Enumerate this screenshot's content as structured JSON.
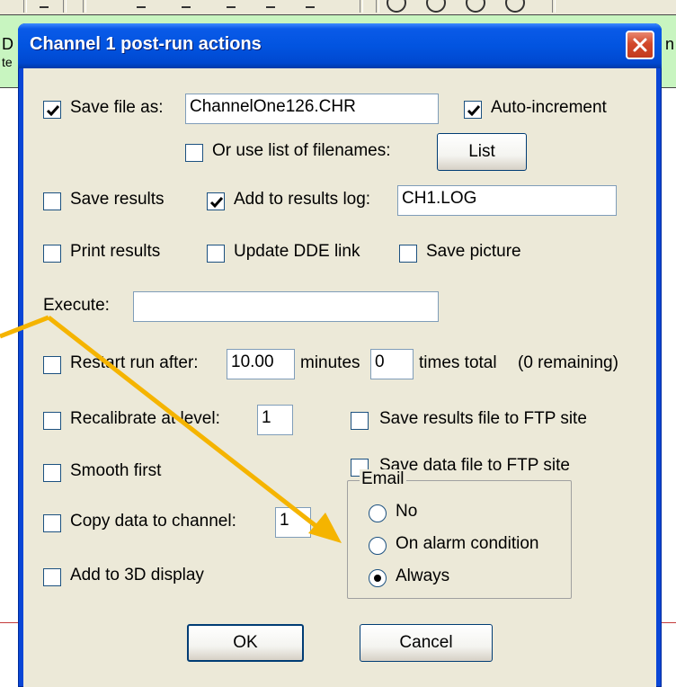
{
  "dialog": {
    "title": "Channel 1 post-run actions",
    "save_file": {
      "label": "Save file as:",
      "checked": true,
      "value": "ChannelOne126.CHR"
    },
    "auto_increment": {
      "label": "Auto-increment",
      "checked": true
    },
    "use_list": {
      "label": "Or use list of filenames:",
      "checked": false
    },
    "list_button": "List",
    "save_results": {
      "label": "Save results",
      "checked": false
    },
    "add_to_log": {
      "label": "Add to results log:",
      "checked": true,
      "value": "CH1.LOG"
    },
    "print_results": {
      "label": "Print results",
      "checked": false
    },
    "update_dde": {
      "label": "Update DDE link",
      "checked": false
    },
    "save_picture": {
      "label": "Save picture",
      "checked": false
    },
    "execute": {
      "label": "Execute:",
      "value": ""
    },
    "restart": {
      "label": "Restart run after:",
      "checked": false,
      "minutes_value": "10.00",
      "minutes_label": "minutes",
      "times_value": "0",
      "times_label": "times total",
      "remaining": "(0 remaining)"
    },
    "recalibrate": {
      "label": "Recalibrate at level:",
      "checked": false,
      "value": "1"
    },
    "save_results_ftp": {
      "label": "Save results file to FTP site",
      "checked": false
    },
    "smooth_first": {
      "label": "Smooth first",
      "checked": false
    },
    "save_data_ftp": {
      "label": "Save data file to FTP site",
      "checked": false
    },
    "copy_data": {
      "label": "Copy data to channel:",
      "checked": false,
      "value": "1"
    },
    "add_3d": {
      "label": "Add to 3D display",
      "checked": false
    },
    "email": {
      "legend": "Email",
      "options": [
        {
          "label": "No",
          "selected": false
        },
        {
          "label": "On alarm condition",
          "selected": false
        },
        {
          "label": "Always",
          "selected": true
        }
      ]
    },
    "ok_button": "OK",
    "cancel_button": "Cancel"
  },
  "background": {
    "left_chars": [
      "D",
      "te"
    ],
    "right_char": "n"
  },
  "colors": {
    "titlebar": "#0054e3",
    "dialog_face": "#ece9d8",
    "close_button": "#d2482a",
    "annotation_arrow": "#f5b400",
    "host_green": "#c8f5c0"
  }
}
